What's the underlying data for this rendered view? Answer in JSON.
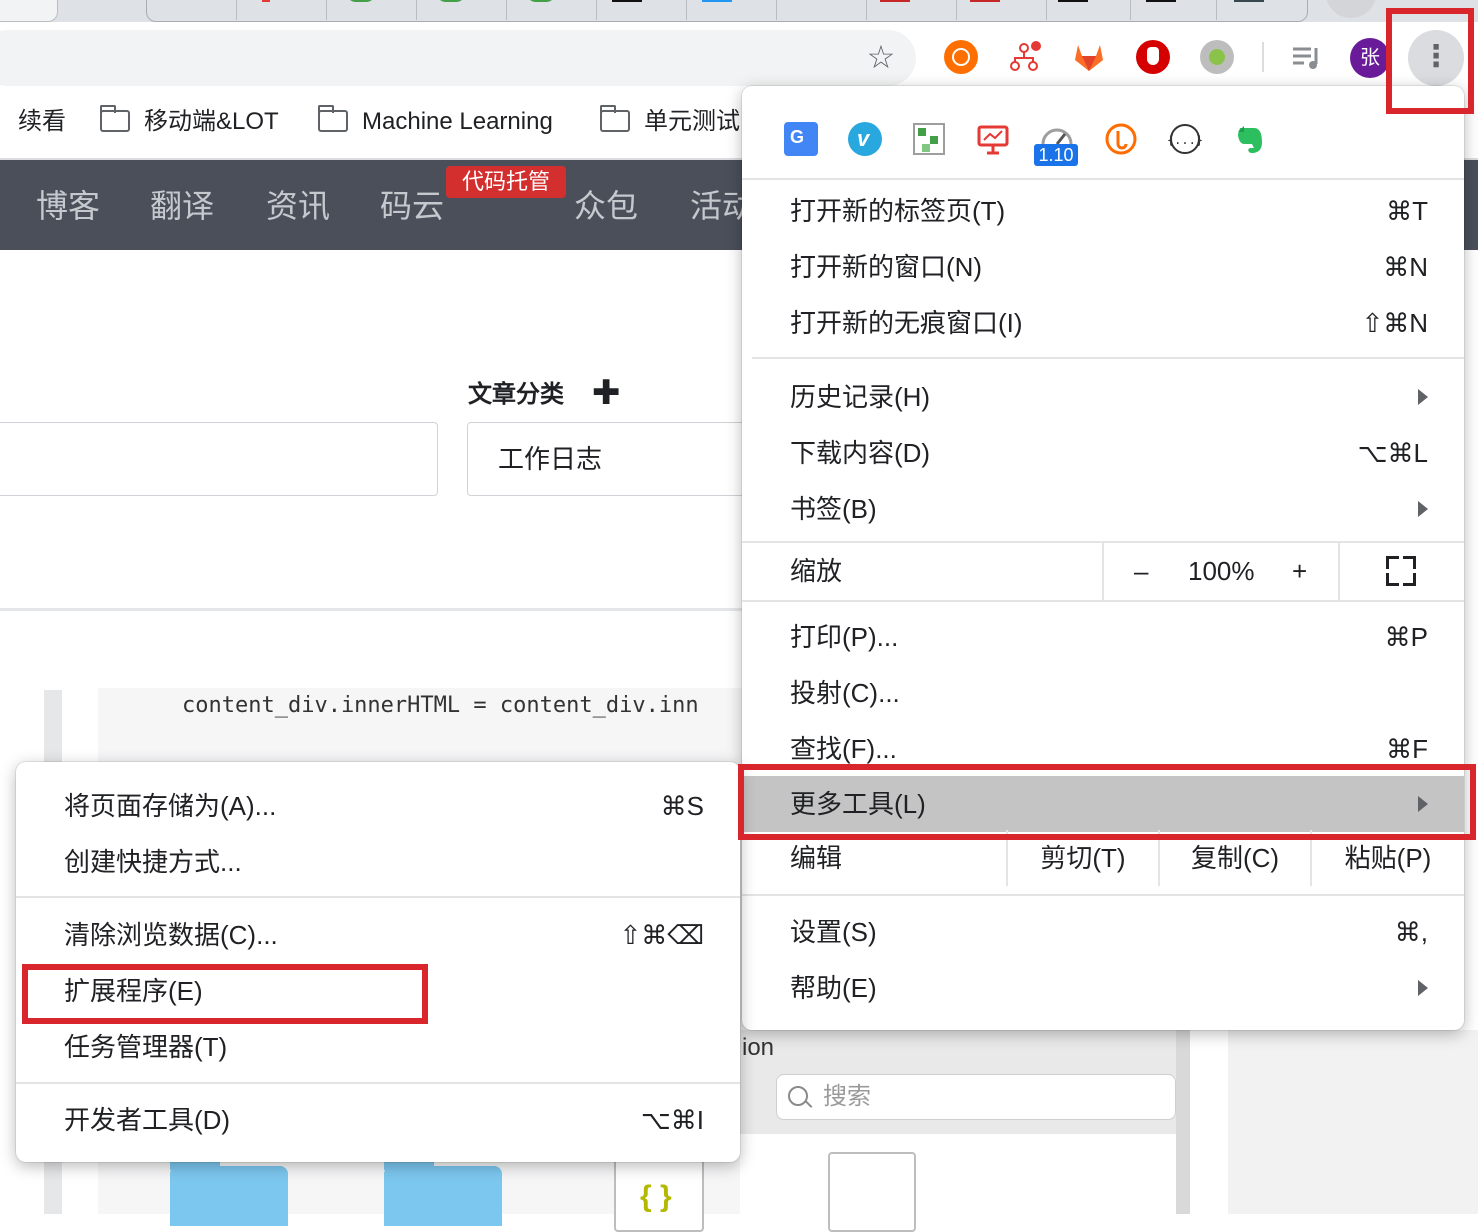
{
  "browser": {
    "profile_initial": "张",
    "bookmarks": [
      {
        "label": "续看",
        "folder": false
      },
      {
        "label": "移动端&LOT",
        "folder": true
      },
      {
        "label": "Machine Learning",
        "folder": true
      },
      {
        "label": "单元测试",
        "folder": true
      }
    ],
    "menu_button_icon": "⋮",
    "bookmark_star": "☆"
  },
  "site_nav": {
    "items": [
      "博客",
      "翻译",
      "资讯",
      "码云",
      "众包",
      "活动"
    ],
    "badge": "代码托管"
  },
  "editor": {
    "category_label": "文章分类",
    "add_icon": "✚",
    "category_value": "工作日志",
    "code_line": "content_div.innerHTML = content_div.inn"
  },
  "finder": {
    "partial_text": "ion",
    "search_placeholder": "搜索"
  },
  "chrome_menu": {
    "extension_version_badge": "1.10",
    "group1": [
      {
        "label": "打开新的标签页(T)",
        "shortcut": "⌘T"
      },
      {
        "label": "打开新的窗口(N)",
        "shortcut": "⌘N"
      },
      {
        "label": "打开新的无痕窗口(I)",
        "shortcut": "⇧⌘N"
      }
    ],
    "group2": [
      {
        "label": "历史记录(H)",
        "shortcut": ""
      },
      {
        "label": "下载内容(D)",
        "shortcut": "⌥⌘L"
      },
      {
        "label": "书签(B)",
        "shortcut": ""
      }
    ],
    "zoom": {
      "label": "缩放",
      "minus": "–",
      "value": "100%",
      "plus": "+"
    },
    "group3": [
      {
        "label": "打印(P)...",
        "shortcut": "⌘P"
      },
      {
        "label": "投射(C)...",
        "shortcut": ""
      },
      {
        "label": "查找(F)...",
        "shortcut": "⌘F"
      },
      {
        "label": "更多工具(L)",
        "shortcut": ""
      }
    ],
    "edit": {
      "label": "编辑",
      "cut": "剪切(T)",
      "copy": "复制(C)",
      "paste": "粘贴(P)"
    },
    "group4": [
      {
        "label": "设置(S)",
        "shortcut": "⌘,"
      },
      {
        "label": "帮助(E)",
        "shortcut": ""
      }
    ]
  },
  "more_tools_menu": {
    "group1": [
      {
        "label": "将页面存储为(A)...",
        "shortcut": "⌘S"
      },
      {
        "label": "创建快捷方式...",
        "shortcut": ""
      }
    ],
    "group2": [
      {
        "label": "清除浏览数据(C)...",
        "shortcut": "⇧⌘⌫"
      },
      {
        "label": "扩展程序(E)",
        "shortcut": ""
      },
      {
        "label": "任务管理器(T)",
        "shortcut": ""
      }
    ],
    "group3": [
      {
        "label": "开发者工具(D)",
        "shortcut": "⌥⌘I"
      }
    ]
  },
  "colors": {
    "annotation_red": "#d9262c",
    "nav_bg": "#4a4f5a",
    "badge_red": "#d32f2f",
    "avatar_purple": "#6a1b9a"
  }
}
